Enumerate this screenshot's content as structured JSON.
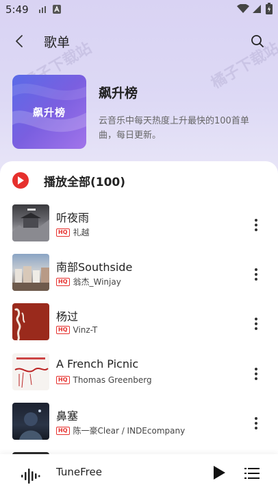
{
  "status_bar": {
    "time": "5:49"
  },
  "header": {
    "title": "歌单"
  },
  "watermark": {
    "text": "橘子下载站"
  },
  "playlist": {
    "cover_text": "飙升榜",
    "name": "飙升榜",
    "description": "云音乐中每天热度上升最快的100首单曲，每日更新。"
  },
  "play_all": {
    "label": "播放全部(100)"
  },
  "songs": [
    {
      "title": "听夜雨",
      "quality": "HQ",
      "artist": "礼越"
    },
    {
      "title": "南部Southside",
      "quality": "HQ",
      "artist": "翁杰_Winjay"
    },
    {
      "title": "杨过",
      "quality": "HQ",
      "artist": "Vinz-T"
    },
    {
      "title": "A French Picnic",
      "quality": "HQ",
      "artist": "Thomas Greenberg"
    },
    {
      "title": "鼻塞",
      "quality": "HQ",
      "artist": "陈一豪Clear / INDEcompany"
    }
  ],
  "player": {
    "name": "TuneFree"
  },
  "colors": {
    "accent": "#e6302d",
    "cover_start": "#5a6be8",
    "cover_end": "#a174ea"
  }
}
